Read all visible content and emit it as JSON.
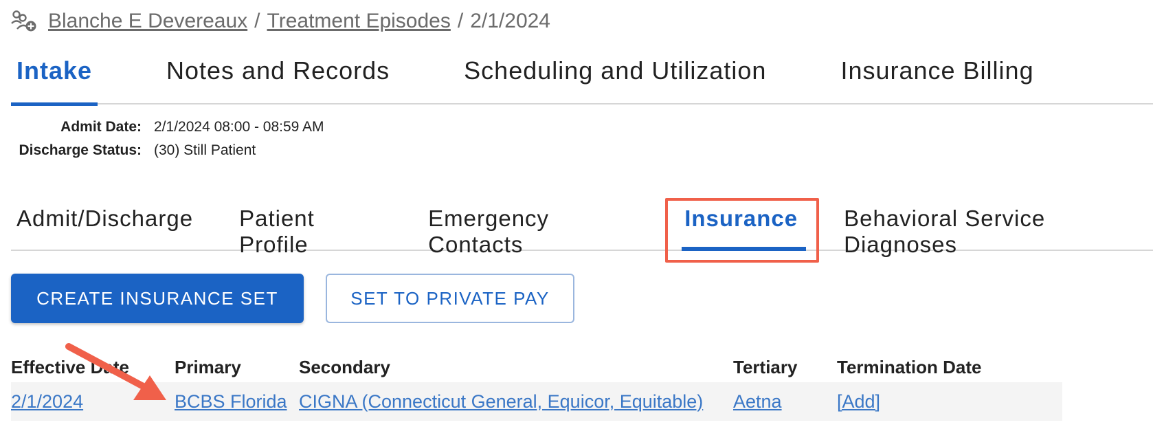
{
  "breadcrumb": {
    "icon": "people-add-icon",
    "patient": "Blanche E Devereaux",
    "section": "Treatment Episodes",
    "current": "2/1/2024",
    "separator": "/"
  },
  "main_tabs": [
    {
      "label": "Intake",
      "active": true
    },
    {
      "label": "Notes and Records",
      "active": false
    },
    {
      "label": "Scheduling and Utilization",
      "active": false
    },
    {
      "label": "Insurance Billing",
      "active": false
    }
  ],
  "episode_info": {
    "admit_date_label": "Admit Date:",
    "admit_date_value": "2/1/2024 08:00 - 08:59 AM",
    "discharge_status_label": "Discharge Status:",
    "discharge_status_value": "(30) Still Patient"
  },
  "sub_tabs": [
    {
      "label": "Admit/Discharge",
      "active": false
    },
    {
      "label": "Patient Profile",
      "active": false
    },
    {
      "label": "Emergency Contacts",
      "active": false
    },
    {
      "label": "Insurance",
      "active": true
    },
    {
      "label": "Behavioral Service Diagnoses",
      "active": false
    }
  ],
  "actions": {
    "create_label": "CREATE INSURANCE SET",
    "private_pay_label": "SET TO PRIVATE PAY"
  },
  "insurance_table": {
    "headers": [
      "Effective Date",
      "Primary",
      "Secondary",
      "Tertiary",
      "Termination Date"
    ],
    "rows": [
      [
        "2/1/2024",
        "BCBS Florida",
        "CIGNA (Connecticut General, Equicor, Equitable)",
        "Aetna",
        "[Add]"
      ]
    ]
  },
  "colors": {
    "accent": "#1b63c4",
    "link": "#3a77c6",
    "annotation": "#f0604a"
  }
}
